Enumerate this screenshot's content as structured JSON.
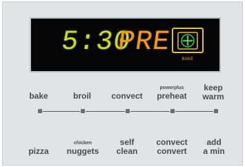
{
  "display": {
    "time": "5:30",
    "mode": "PRE",
    "icon": "convection-fan-icon",
    "indicator_label": "BAKE",
    "colors": {
      "time": "#c8dd2a",
      "mode": "#f29a18",
      "icon_frame": "#e7c31a",
      "icon_fan": "#34c35a"
    }
  },
  "buttons_top": {
    "bake": "bake",
    "broil": "broil",
    "convect": "convect",
    "preheat_sub": "powerplus",
    "preheat": "preheat",
    "keep_warm_1": "keep",
    "keep_warm_2": "warm"
  },
  "buttons_bottom": {
    "pizza": "pizza",
    "nuggets_sub": "chicken",
    "nuggets": "nuggets",
    "self_clean_1": "self",
    "self_clean_2": "clean",
    "convect_convert_1": "convect",
    "convect_convert_2": "convert",
    "add_min_1": "add",
    "add_min_2": "a min"
  }
}
